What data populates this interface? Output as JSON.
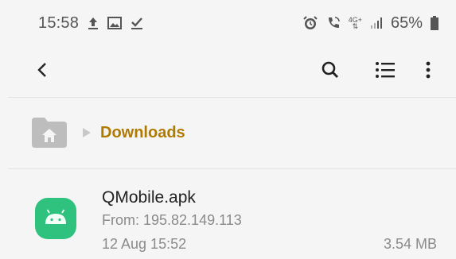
{
  "status_bar": {
    "time": "15:58",
    "battery_percent": "65%",
    "network_label": "4G+",
    "left_icons": [
      "upload-icon",
      "image-icon",
      "check-download-icon"
    ],
    "right_icons": [
      "alarm-icon",
      "wifi-call-icon",
      "network-icon",
      "signal-icon",
      "battery-icon"
    ]
  },
  "toolbar": {
    "icons": [
      "back-icon",
      "search-icon",
      "list-view-icon",
      "more-options-icon"
    ]
  },
  "breadcrumb": {
    "home_icon": "home-folder-icon",
    "current": "Downloads",
    "accent_color": "#b07a00"
  },
  "files": [
    {
      "name": "QMobile.apk",
      "source": "From: 195.82.149.113",
      "date": "12 Aug 15:52",
      "size": "3.54 MB",
      "icon": "android-apk-icon",
      "icon_color": "#3ddc84"
    }
  ]
}
